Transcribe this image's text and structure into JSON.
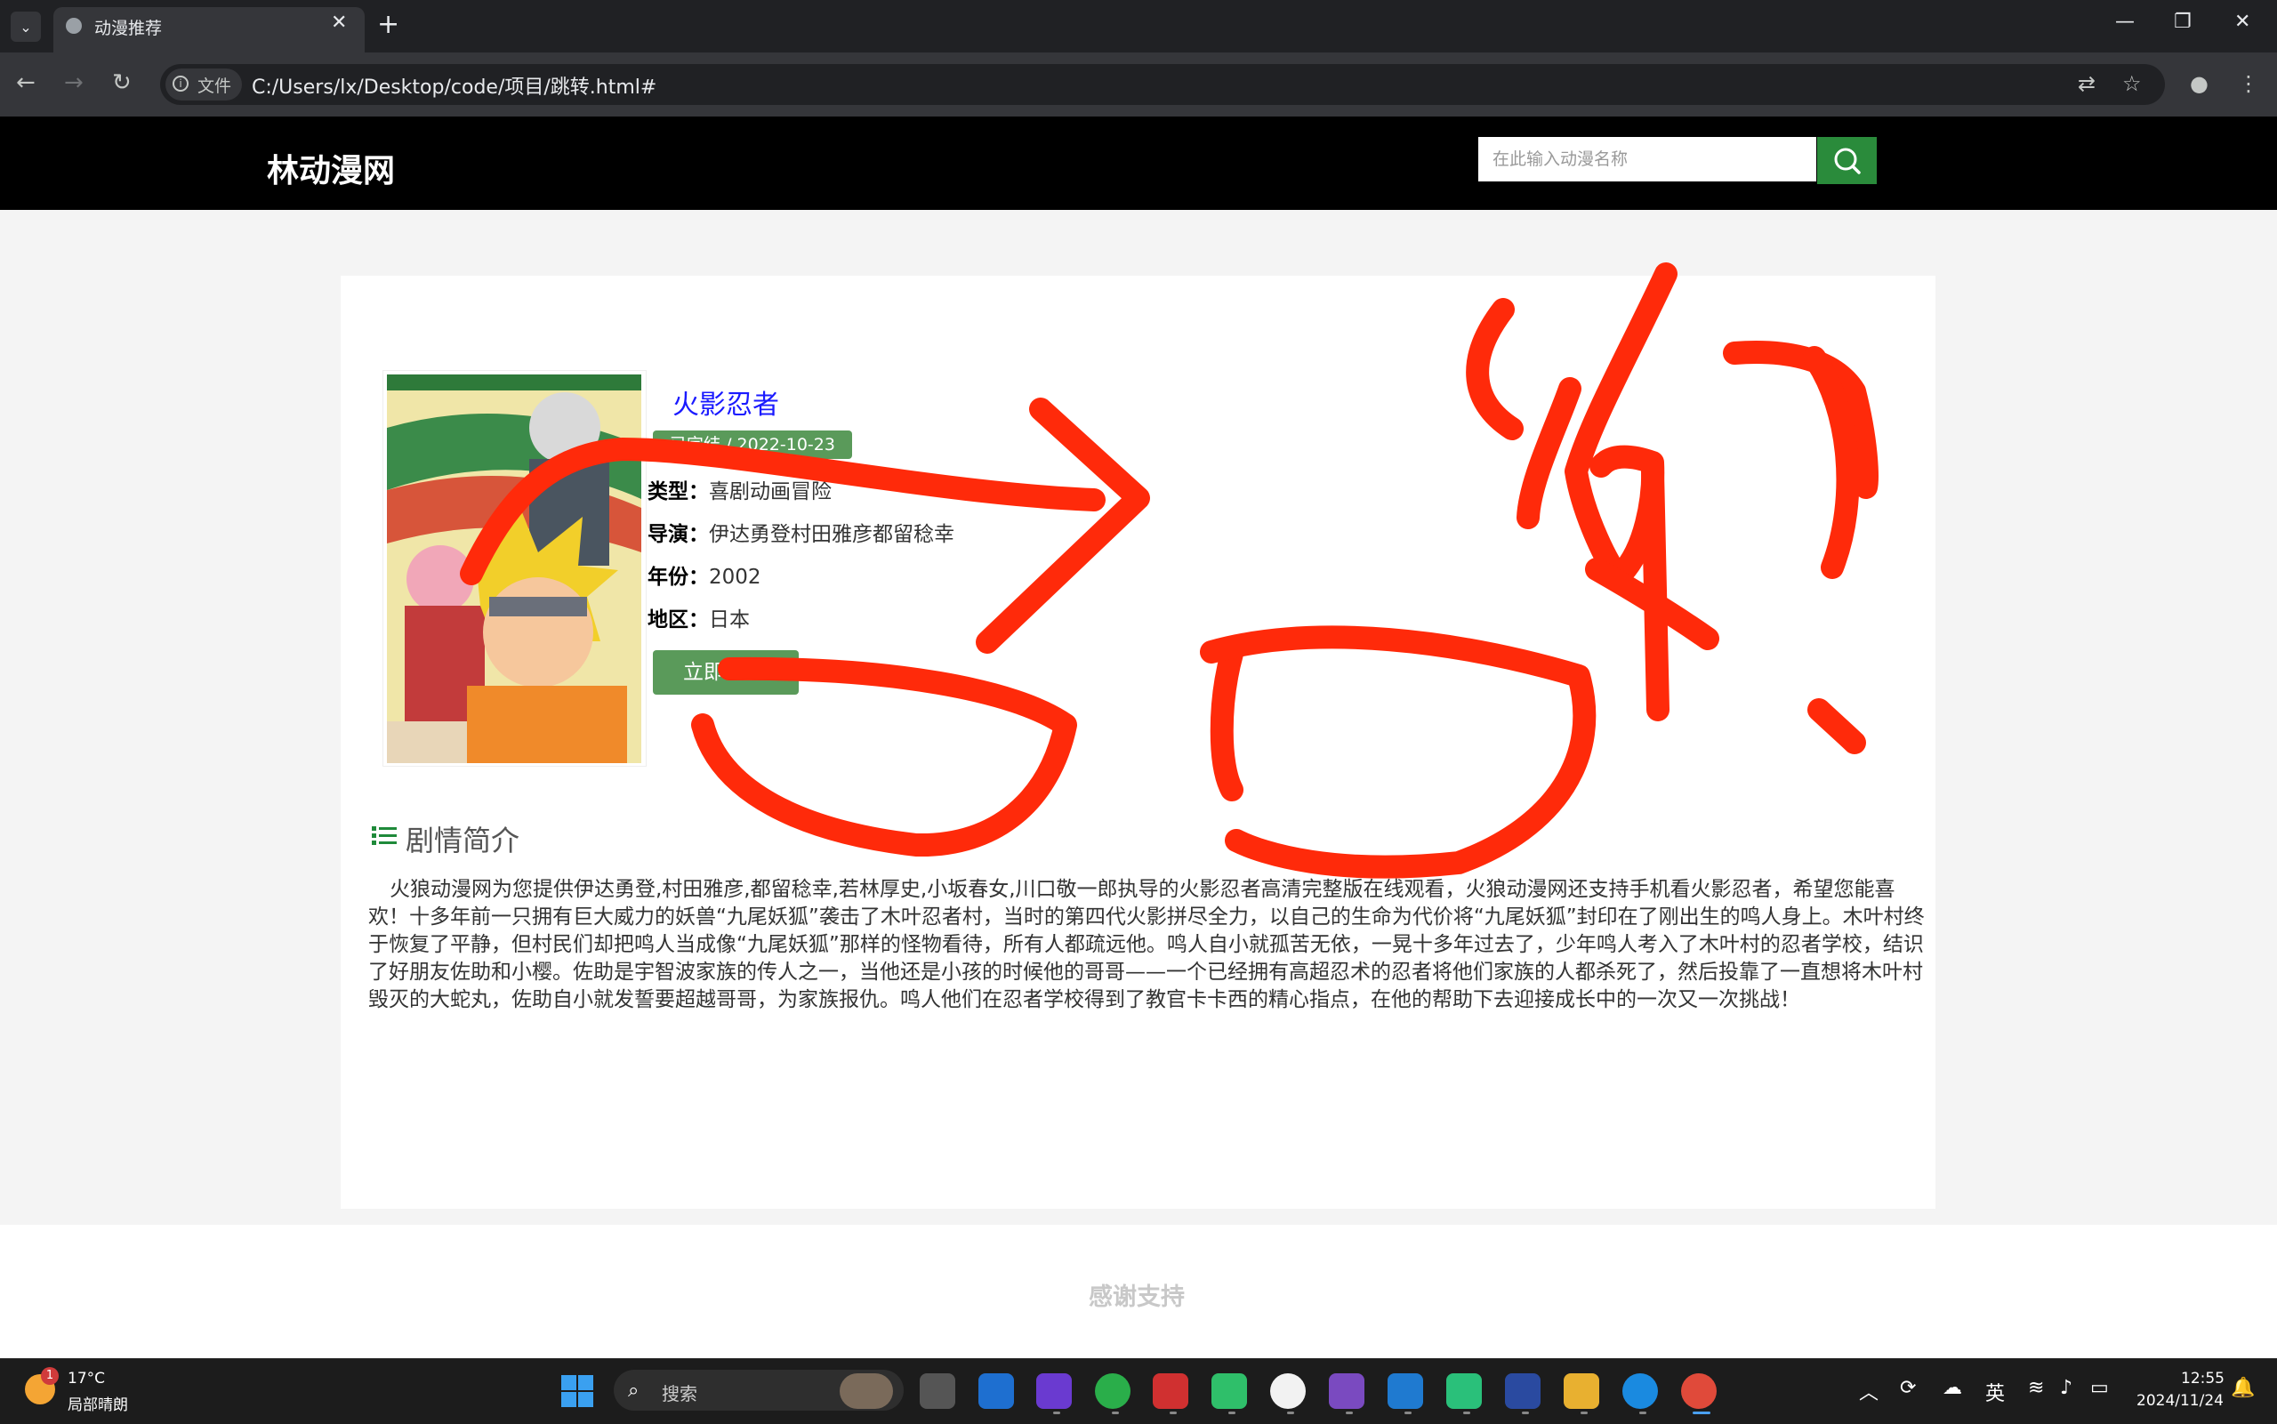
{
  "browser": {
    "tab_title": "动漫推荐",
    "site_label": "文件",
    "url": "C:/Users/lx/Desktop/code/项目/跳转.html#"
  },
  "header": {
    "logo": "林动漫网",
    "search_placeholder": "在此输入动漫名称"
  },
  "anime": {
    "title": "火影忍者",
    "status": "已完结 / 2022-10-23",
    "fields": [
      {
        "label": "类型：",
        "value": "喜剧动画冒险"
      },
      {
        "label": "导演：",
        "value": "伊达勇登村田雅彦都留稔幸"
      },
      {
        "label": "年份：",
        "value": "2002"
      },
      {
        "label": "地区：",
        "value": "日本"
      }
    ],
    "watch_label": "立即"
  },
  "synopsis": {
    "heading": "剧情简介",
    "text": "火狼动漫网为您提供伊达勇登,村田雅彦,都留稔幸,若林厚史,小坂春女,川口敬一郎执导的火影忍者高清完整版在线观看，火狼动漫网还支持手机看火影忍者，希望您能喜欢！十多年前一只拥有巨大威力的妖兽“九尾妖狐”袭击了木叶忍者村，当时的第四代火影拼尽全力，以自己的生命为代价将“九尾妖狐”封印在了刚出生的鸣人身上。木叶村终于恢复了平静，但村民们却把鸣人当成像“九尾妖狐”那样的怪物看待，所有人都疏远他。鸣人自小就孤苦无依，一晃十多年过去了，少年鸣人考入了木叶村的忍者学校，结识了好朋友佐助和小樱。佐助是宇智波家族的传人之一，当他还是小孩的时候他的哥哥——一个已经拥有高超忍术的忍者将他们家族的人都杀死了，然后投靠了一直想将木叶村毁灭的大蛇丸，佐助自小就发誓要超越哥哥，为家族报仇。鸣人他们在忍者学校得到了教官卡卡西的精心指点，在他的帮助下去迎接成长中的一次又一次挑战！"
  },
  "footer": {
    "text": "感谢支持"
  },
  "taskbar": {
    "weather_temp": "17°C",
    "weather_desc": "局部晴朗",
    "weather_badge": "1",
    "search_label": "搜索",
    "ime": "英",
    "time": "12:55",
    "date": "2024/11/24"
  },
  "colors": {
    "header_bg": "#000000",
    "accent_green": "#2a8b3b",
    "badge_green": "#5a9a5a",
    "title_blue": "#1a1aff",
    "scribble_red": "#ff2a0a"
  }
}
